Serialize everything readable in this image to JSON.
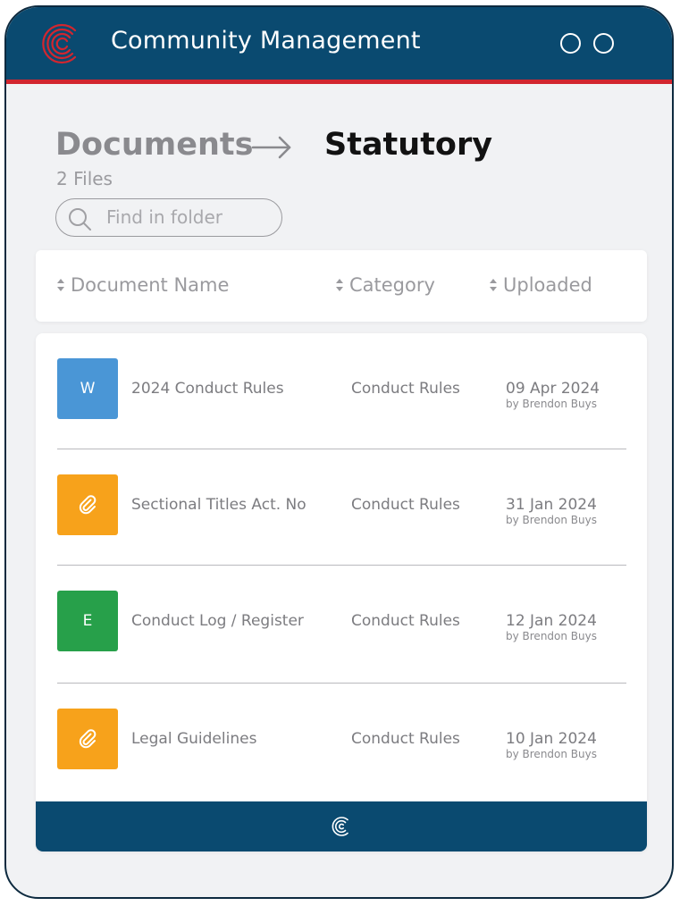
{
  "app": {
    "title": "Community Management",
    "logo_icon": "concentric-c-logo-icon"
  },
  "breadcrumb": {
    "root": "Documents",
    "current": "Statutory"
  },
  "folder": {
    "file_count": "2 Files"
  },
  "search": {
    "placeholder": "Find in folder",
    "value": ""
  },
  "table": {
    "columns": [
      {
        "label": "Document Name"
      },
      {
        "label": "Category"
      },
      {
        "label": "Uploaded"
      }
    ],
    "rows": [
      {
        "icon": "word-file-icon",
        "icon_letter": "W",
        "icon_color": "#4a96d6",
        "name": "2024 Conduct Rules",
        "category": "Conduct Rules",
        "date": "09 Apr 2024",
        "by": "by Brendon Buys"
      },
      {
        "icon": "paperclip-icon",
        "icon_letter": "",
        "icon_color": "#f7a21b",
        "name": "Sectional Titles Act. No",
        "category": "Conduct Rules",
        "date": "31 Jan 2024",
        "by": "by Brendon Buys"
      },
      {
        "icon": "excel-file-icon",
        "icon_letter": "E",
        "icon_color": "#27a04a",
        "name": "Conduct Log / Register",
        "category": "Conduct Rules",
        "date": "12 Jan 2024",
        "by": "by Brendon Buys"
      },
      {
        "icon": "paperclip-icon",
        "icon_letter": "",
        "icon_color": "#f7a21b",
        "name": "Legal Guidelines",
        "category": "Conduct Rules",
        "date": "10 Jan 2024",
        "by": "by Brendon Buys"
      }
    ]
  },
  "colors": {
    "header_bg": "#0a4a70",
    "accent_red": "#d2262f",
    "page_bg": "#f1f2f4"
  }
}
